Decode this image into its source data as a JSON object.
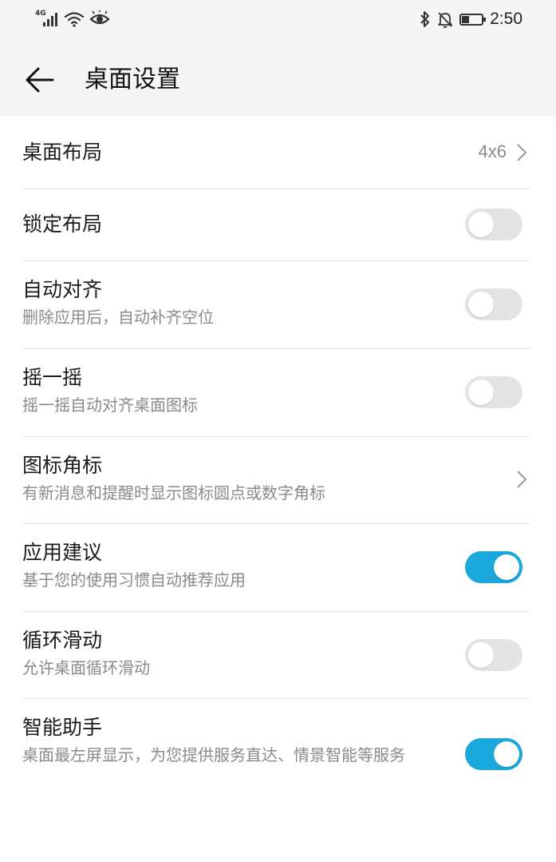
{
  "status_bar": {
    "network_label": "4G",
    "time": "2:50",
    "icons": [
      "signal-icon",
      "wifi-icon",
      "eye-icon",
      "bluetooth-icon",
      "mute-icon",
      "battery-icon"
    ]
  },
  "header": {
    "title": "桌面设置"
  },
  "settings": [
    {
      "title": "桌面布局",
      "value": "4x6",
      "control": "chevron"
    },
    {
      "title": "锁定布局",
      "control": "toggle",
      "on": false
    },
    {
      "title": "自动对齐",
      "subtitle": "删除应用后，自动补齐空位",
      "control": "toggle",
      "on": false
    },
    {
      "title": "摇一摇",
      "subtitle": "摇一摇自动对齐桌面图标",
      "control": "toggle",
      "on": false
    },
    {
      "title": "图标角标",
      "subtitle": "有新消息和提醒时显示图标圆点或数字角标",
      "control": "chevron"
    },
    {
      "title": "应用建议",
      "subtitle": "基于您的使用习惯自动推荐应用",
      "control": "toggle",
      "on": true
    },
    {
      "title": "循环滑动",
      "subtitle": "允许桌面循环滑动",
      "control": "toggle",
      "on": false
    },
    {
      "title": "智能助手",
      "subtitle": "桌面最左屏显示，为您提供服务直达、情景智能等服务",
      "control": "toggle",
      "on": true
    }
  ],
  "colors": {
    "accent": "#1aa8dc",
    "toggle_off": "#e4e4e4",
    "header_bg": "#f5f5f5"
  }
}
